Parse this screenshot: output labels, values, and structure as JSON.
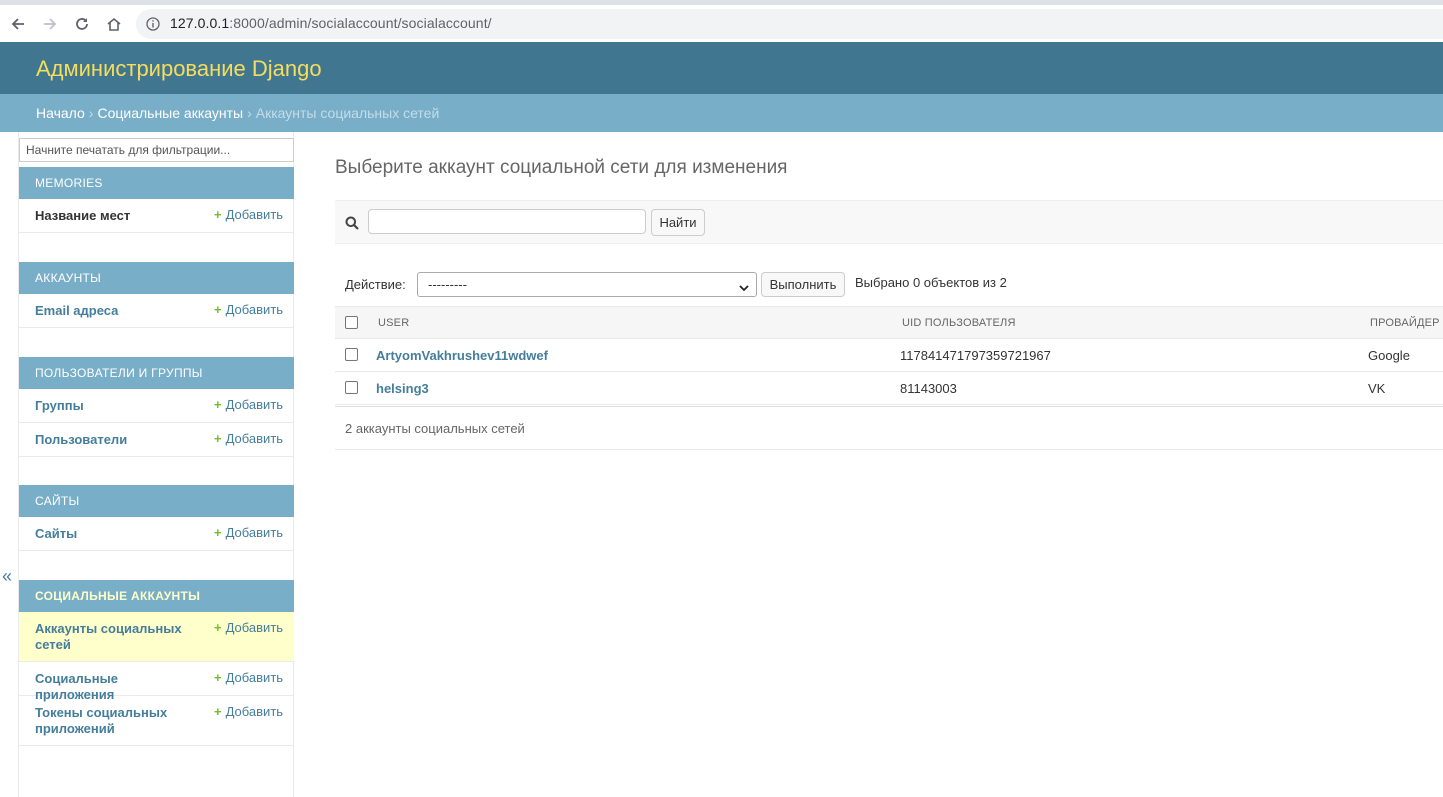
{
  "browser": {
    "url_host": "127.0.0.1",
    "url_rest": ":8000/admin/socialaccount/socialaccount/"
  },
  "header": {
    "site_title": "Администрирование Django"
  },
  "breadcrumbs": {
    "home": "Начало",
    "app": "Социальные аккаунты",
    "current": "Аккаунты социальных сетей",
    "separator": "›"
  },
  "sidebar": {
    "filter_placeholder": "Начните печатать для фильтрации...",
    "add_label": "Добавить",
    "add_glyph": "+",
    "collapse_glyph": "«",
    "modules": [
      {
        "caption": "MEMORIES",
        "items": [
          {
            "name": "Название мест"
          }
        ]
      },
      {
        "caption": "АККАУНТЫ",
        "items": [
          {
            "name": "Email адреса"
          }
        ]
      },
      {
        "caption": "ПОЛЬЗОВАТЕЛИ И ГРУППЫ",
        "items": [
          {
            "name": "Группы"
          },
          {
            "name": "Пользователи"
          }
        ]
      },
      {
        "caption": "САЙТЫ",
        "items": [
          {
            "name": "Сайты"
          }
        ]
      },
      {
        "caption": "СОЦИАЛЬНЫЕ АККАУНТЫ",
        "items": [
          {
            "name": "Аккаунты социальных сетей"
          },
          {
            "name": "Социальные приложения"
          },
          {
            "name": "Токены социальных приложений"
          }
        ]
      }
    ]
  },
  "main": {
    "heading": "Выберите аккаунт социальной сети для изменения",
    "search": {
      "value": "",
      "button": "Найти"
    },
    "actions": {
      "label": "Действие:",
      "selected": "---------",
      "go_button": "Выполнить",
      "counter": "Выбрано 0 объектов из 2"
    },
    "table": {
      "columns": [
        "USER",
        "UID ПОЛЬЗОВАТЕЛЯ",
        "ПРОВАЙДЕР"
      ],
      "rows": [
        {
          "user": "ArtyomVakhrushev11wdwef",
          "uid": "117841471797359721967",
          "provider": "Google"
        },
        {
          "user": "helsing3",
          "uid": "81143003",
          "provider": "VK"
        }
      ]
    },
    "result_count": "2 аккаунты социальных сетей"
  },
  "colors": {
    "header_bg": "#417690",
    "breadcrumbs_bg": "#79aec8",
    "title_color": "#f5dd5d",
    "link_color": "#447e9b",
    "add_plus_color": "#70bf2b",
    "current_row_bg": "#ffffcc"
  }
}
